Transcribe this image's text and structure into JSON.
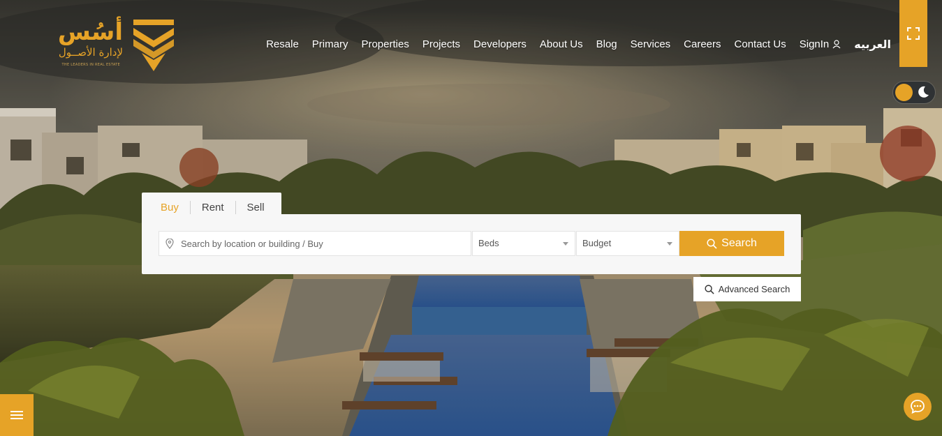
{
  "brand": {
    "name_ar": "أسُس",
    "subtitle_ar": "لإدارة الأصــول",
    "tagline": "THE LEADERS IN REAL ESTATE",
    "accent_color": "#e6a327"
  },
  "nav": {
    "items": [
      "Resale",
      "Primary",
      "Properties",
      "Projects",
      "Developers",
      "About Us",
      "Blog",
      "Services",
      "Careers",
      "Contact Us"
    ],
    "signin": "SignIn",
    "language": "العربيه"
  },
  "icons": {
    "fullscreen": "fullscreen-icon",
    "theme_toggle": "moon-icon",
    "user": "user-icon",
    "location": "location-pin-icon",
    "search": "search-icon",
    "menu": "hamburger-icon",
    "chat": "chat-icon"
  },
  "search": {
    "tabs": [
      "Buy",
      "Rent",
      "Sell"
    ],
    "active_tab": "Buy",
    "placeholder": "Search by location or building / Buy",
    "beds": "Beds",
    "budget": "Budget",
    "button": "Search",
    "advanced": "Advanced Search"
  }
}
